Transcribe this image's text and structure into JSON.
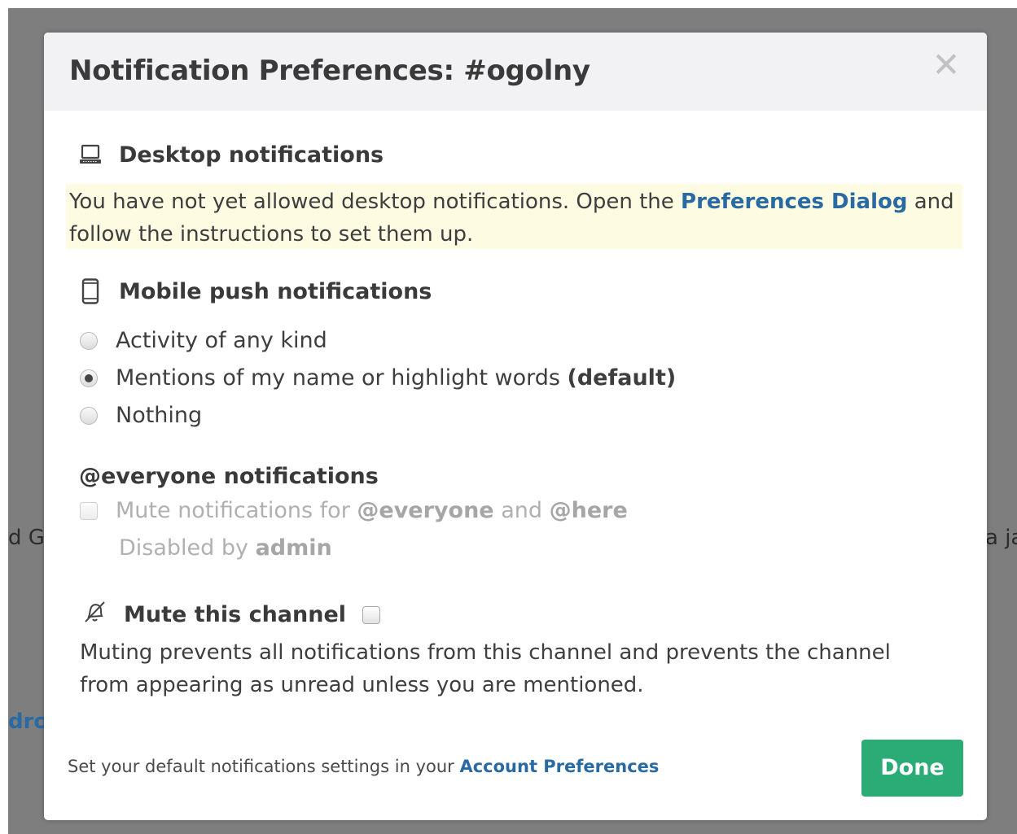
{
  "background": {
    "left_fragment": "d Go",
    "right_fragment": "a ja",
    "link_fragment": "dro"
  },
  "modal": {
    "title": "Notification Preferences: #ogolny",
    "close_glyph": "✕",
    "desktop": {
      "title": "Desktop notifications",
      "icon": "laptop-icon",
      "warning_before": "You have not yet allowed desktop notifications. Open the ",
      "warning_link": "Preferences Dialog",
      "warning_after": " and follow the instructions to set them up."
    },
    "mobile": {
      "title": "Mobile push notifications",
      "icon": "phone-icon",
      "options": [
        {
          "label": "Activity of any kind",
          "bold_suffix": "",
          "checked": false
        },
        {
          "label": "Mentions of my name or highlight words ",
          "bold_suffix": "(default)",
          "checked": true
        },
        {
          "label": "Nothing",
          "bold_suffix": "",
          "checked": false
        }
      ]
    },
    "everyone": {
      "title": "@everyone notifications",
      "mute_prefix": "Mute notifications for ",
      "everyone_tag": "@everyone",
      "and_word": " and ",
      "here_tag": "@here",
      "disabled_prefix": "Disabled by ",
      "disabled_by": "admin"
    },
    "mute_channel": {
      "title": "Mute this channel",
      "icon": "bell-off-icon",
      "description": "Muting prevents all notifications from this channel and prevents the channel from appearing as unread unless you are mentioned.",
      "checked": false
    },
    "footer": {
      "text": "Set your default notifications settings in your ",
      "link": "Account Preferences",
      "done_label": "Done"
    }
  },
  "colors": {
    "accent_link": "#2a6aa3",
    "done_button": "#2bac76",
    "warning_bg": "#fdfbe2",
    "header_bg": "#f2f2f4"
  }
}
